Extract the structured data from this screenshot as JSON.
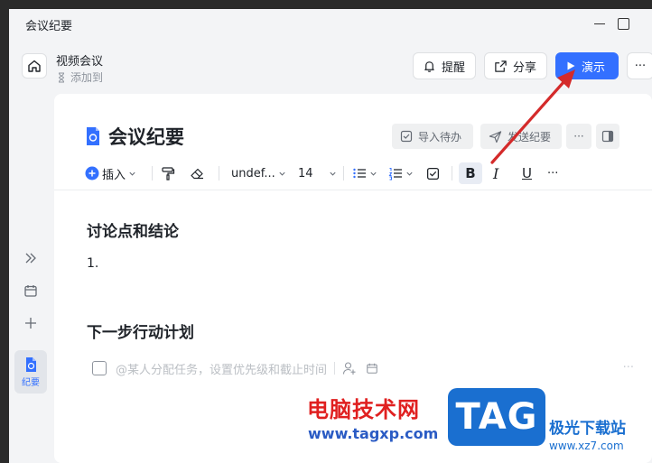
{
  "window": {
    "title": "会议纪要"
  },
  "header": {
    "meeting_name": "视频会议",
    "add_to": "添加到",
    "remind_label": "提醒",
    "share_label": "分享",
    "present_label": "演示",
    "more_label": "···"
  },
  "sidebar": {
    "active_label": "纪要"
  },
  "doc": {
    "title": "会议纪要",
    "import_todo_label": "导入待办",
    "send_minutes_label": "发送纪要",
    "more_label": "···"
  },
  "toolbar": {
    "insert_label": "插入",
    "font_family": "undef...",
    "font_size": "14",
    "bold": "B",
    "italic": "I",
    "underline": "U",
    "more": "···"
  },
  "content": {
    "section1_heading": "讨论点和结论",
    "list_item_1": "1.",
    "section2_heading": "下一步行动计划",
    "task_placeholder": "@某人分配任务，设置优先级和截止时间",
    "task_more": "···"
  },
  "watermark": {
    "cn_text": "电脑技术网",
    "url": "www.tagxp.com",
    "logo": "TAG",
    "site_name": "极光下载站",
    "site_url": "www.xz7.com"
  },
  "colors": {
    "accent": "#3370ff",
    "arrow": "#d42a2a"
  }
}
